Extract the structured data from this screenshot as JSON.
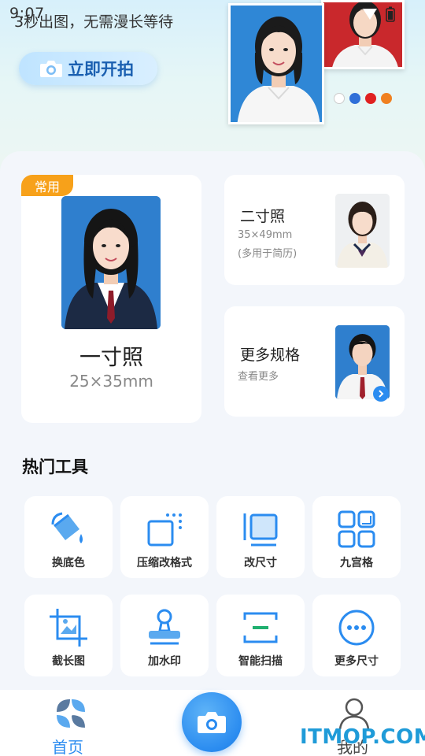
{
  "status_bar": {
    "time": "9:07"
  },
  "hero": {
    "tagline": "3秒出图，无需漫长等待",
    "shoot_label": "立即开拍",
    "background_colors": [
      "#ffffff",
      "#2f6fd8",
      "#e02020",
      "#f08020"
    ]
  },
  "cards": {
    "one_inch": {
      "badge": "常用",
      "title": "一寸照",
      "size": "25×35mm"
    },
    "two_inch": {
      "title": "二寸照",
      "size": "35×49mm",
      "note": "(多用于简历)"
    },
    "more": {
      "title": "更多规格",
      "note": "查看更多"
    }
  },
  "tools": {
    "section_title": "热门工具",
    "items": [
      {
        "label": "换底色",
        "icon": "paint-bucket-icon"
      },
      {
        "label": "压缩改格式",
        "icon": "compress-icon"
      },
      {
        "label": "改尺寸",
        "icon": "resize-icon"
      },
      {
        "label": "九宫格",
        "icon": "grid-icon"
      },
      {
        "label": "截长图",
        "icon": "crop-icon"
      },
      {
        "label": "加水印",
        "icon": "stamp-icon"
      },
      {
        "label": "智能扫描",
        "icon": "scan-icon"
      },
      {
        "label": "更多尺寸",
        "icon": "more-icon"
      }
    ]
  },
  "bottom_nav": {
    "home_label": "首页",
    "mine_label": "我的",
    "accent": "#2b8cf0"
  },
  "watermark": "ITMOP.COM"
}
